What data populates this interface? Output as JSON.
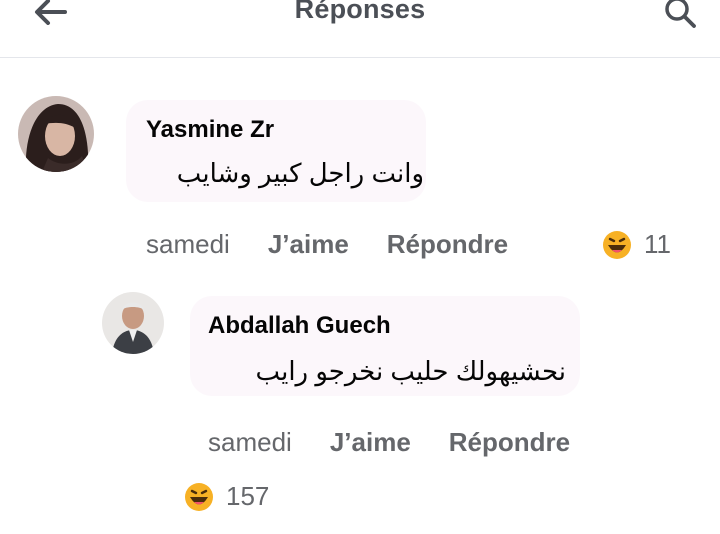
{
  "header": {
    "back_icon": "arrow-left-icon",
    "title": "Réponses",
    "search_icon": "search-icon"
  },
  "comments": [
    {
      "author": "Yasmine Zr",
      "text": "وانت راجل كبير وشايب",
      "time": "samedi",
      "like_label": "J’aime",
      "reply_label": "Répondre",
      "reaction_icon": "haha-emoji-icon",
      "reaction_count": "11"
    },
    {
      "author": "Abdallah Guech",
      "text": "نحشيهولك حليب نخرجو رايب",
      "time": "samedi",
      "like_label": "J’aime",
      "reply_label": "Répondre",
      "reaction_icon": "haha-emoji-icon",
      "reaction_count": "157"
    }
  ],
  "colors": {
    "text_primary": "#050505",
    "text_secondary": "#65676b",
    "title": "#4b4f56",
    "bubble": "#fcf7fb",
    "divider": "#e4e6eb",
    "haha_yellow": "#f7b125"
  }
}
